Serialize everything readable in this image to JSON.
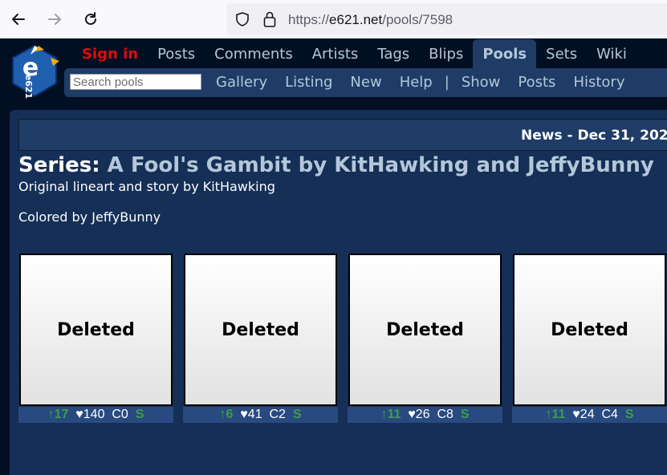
{
  "browser": {
    "url_scheme": "https://",
    "url_host": "e621.net",
    "url_path": "/pools/7598",
    "icons": [
      "back-arrow-icon",
      "forward-arrow-icon",
      "reload-icon",
      "shield-icon",
      "lock-icon"
    ]
  },
  "site": {
    "logo_text": "e621",
    "main_nav": [
      "Sign in",
      "Posts",
      "Comments",
      "Artists",
      "Tags",
      "Blips",
      "Pools",
      "Sets",
      "Wiki"
    ],
    "active_item": "Pools",
    "search_placeholder": "Search pools",
    "sub_nav_left": [
      "Gallery",
      "Listing",
      "New",
      "Help"
    ],
    "sub_nav_separator": "|",
    "sub_nav_right": [
      "Show",
      "Posts",
      "History"
    ]
  },
  "news": {
    "text": "News - Dec 31, 202"
  },
  "pool": {
    "category": "Series:",
    "name": "A Fool's Gambit by KitHawking and JeffyBunny",
    "description_lines": [
      "Original lineart and story by KitHawking",
      "Colored by JeffyBunny"
    ]
  },
  "posts": [
    {
      "label": "Deleted",
      "score": "↑17",
      "favs": "♥140",
      "comments": "C0",
      "rating": "S"
    },
    {
      "label": "Deleted",
      "score": "↑6",
      "favs": "♥41",
      "comments": "C2",
      "rating": "S"
    },
    {
      "label": "Deleted",
      "score": "↑11",
      "favs": "♥26",
      "comments": "C8",
      "rating": "S"
    },
    {
      "label": "Deleted",
      "score": "↑11",
      "favs": "♥24",
      "comments": "C4",
      "rating": "S"
    }
  ],
  "colors": {
    "background": "#020f23",
    "section": "#152f56",
    "nav": "#1f3c67",
    "link": "#b4c7d9",
    "signin": "#e00a0a",
    "score_up": "#3e9e49"
  }
}
